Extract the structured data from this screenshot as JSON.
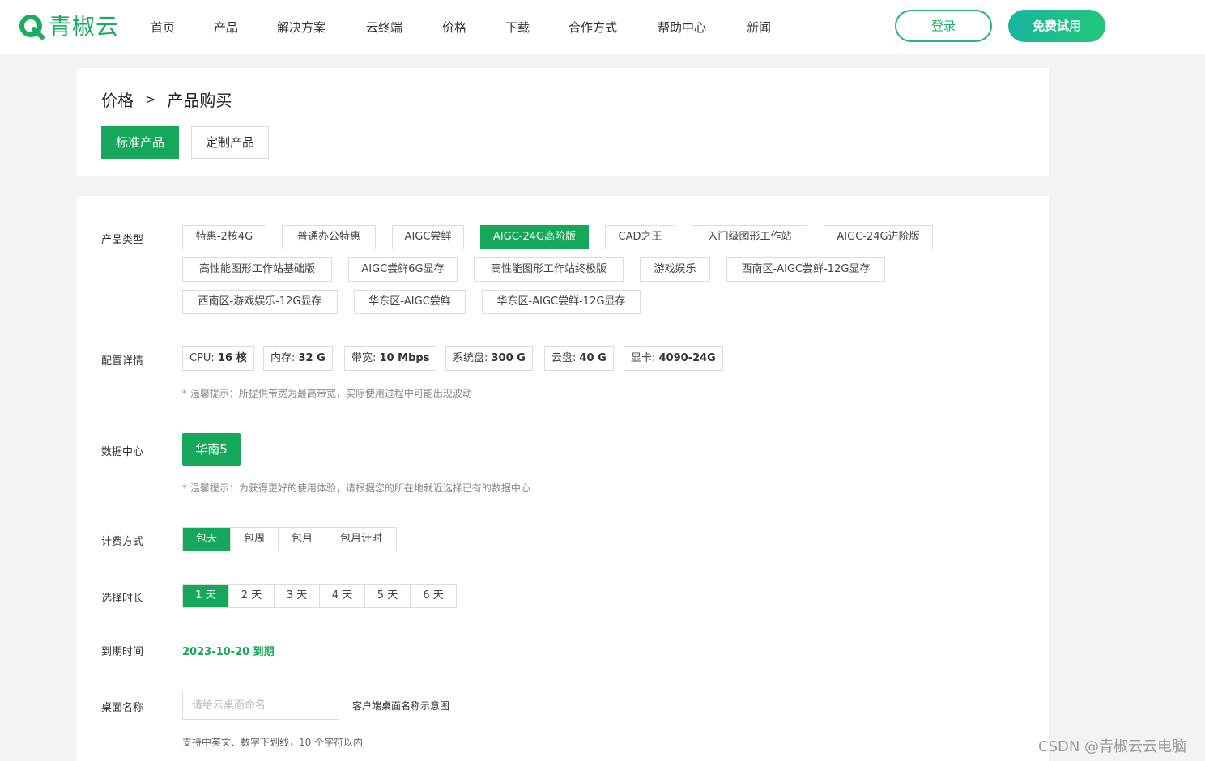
{
  "header": {
    "logo_text": "青椒云",
    "nav": [
      "首页",
      "产品",
      "解决方案",
      "云终端",
      "价格",
      "下载",
      "合作方式",
      "帮助中心",
      "新闻"
    ],
    "login": "登录",
    "trial": "免费试用"
  },
  "breadcrumb": {
    "root": "价格",
    "sep": ">",
    "current": "产品购买"
  },
  "tabs": {
    "standard": "标准产品",
    "custom": "定制产品"
  },
  "product_type": {
    "label": "产品类型",
    "options": [
      "特惠-2核4G",
      "普通办公特惠",
      "AIGC尝鲜",
      "AIGC-24G高阶版",
      "CAD之王",
      "入门级图形工作站",
      "AIGC-24G进阶版",
      "高性能图形工作站基础版",
      "AIGC尝鲜6G显存",
      "高性能图形工作站终极版",
      "游戏娱乐",
      "西南区-AIGC尝鲜-12G显存",
      "西南区-游戏娱乐-12G显存",
      "华东区-AIGC尝鲜",
      "华东区-AIGC尝鲜-12G显存"
    ],
    "selected": "AIGC-24G高阶版"
  },
  "config": {
    "label": "配置详情",
    "specs": [
      {
        "k": "CPU: ",
        "v": "16 核"
      },
      {
        "k": "内存: ",
        "v": "32 G"
      },
      {
        "k": "带宽: ",
        "v": "10 Mbps"
      },
      {
        "k": "系统盘: ",
        "v": "300 G"
      },
      {
        "k": "云盘: ",
        "v": "40 G"
      },
      {
        "k": "显卡: ",
        "v": "4090-24G"
      }
    ],
    "hint": "* 温馨提示：所提供带宽为最高带宽，实际使用过程中可能出现波动"
  },
  "datacenter": {
    "label": "数据中心",
    "value": "华南5",
    "hint": "* 温馨提示：为获得更好的使用体验，请根据您的所在地就近选择已有的数据中心"
  },
  "billing": {
    "label": "计费方式",
    "options": [
      "包天",
      "包周",
      "包月",
      "包月计时"
    ],
    "selected": "包天"
  },
  "duration": {
    "label": "选择时长",
    "options": [
      "1 天",
      "2 天",
      "3 天",
      "4 天",
      "5 天",
      "6 天"
    ],
    "selected": "1 天"
  },
  "expiry": {
    "label": "到期时间",
    "value": "2023-10-20 到期"
  },
  "desktop_name": {
    "label": "桌面名称",
    "placeholder": "请给云桌面命名",
    "link": "客户端桌面名称示意图",
    "hint": "支持中英文、数字下划线，10 个字符以内"
  },
  "watermark": "CSDN @青椒云云电脑",
  "colors": {
    "primary": "#16a85a",
    "trial_start": "#17b5a0",
    "trial_end": "#22c779"
  }
}
